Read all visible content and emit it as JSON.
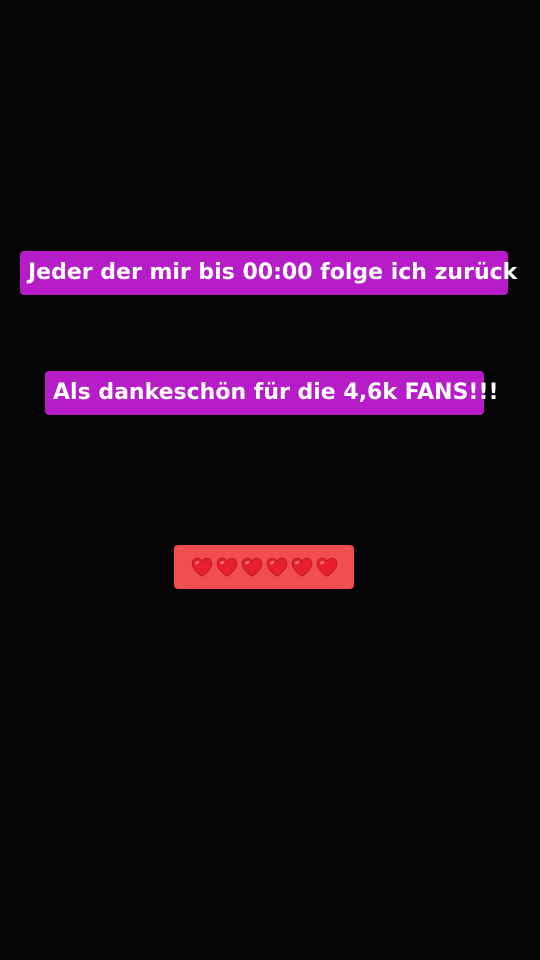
{
  "captions": {
    "line1": "Jeder der mir bis 00:00 folge ich zurück",
    "line2": "Als dankeschön für die 4,6k FANS!!!"
  },
  "hearts": {
    "icon": "red-heart-emoji",
    "count": 6,
    "color": "#e8202b"
  },
  "colors": {
    "background": "#040404",
    "caption_bg": "#b71cc9",
    "hearts_bg": "#f24e50"
  }
}
